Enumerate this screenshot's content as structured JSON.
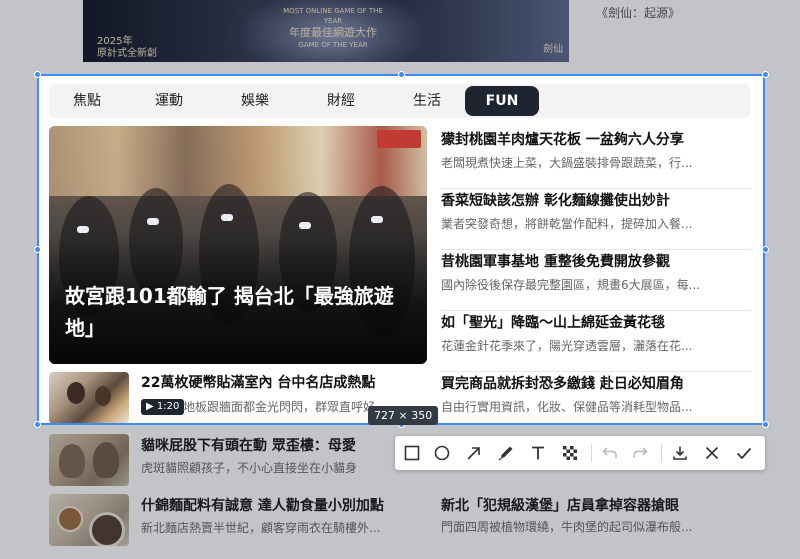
{
  "background": {
    "banner": {
      "left_text": "2025年\n原計式全新創",
      "mid_small": "MOST ONLINE GAME OF THE YEAR",
      "mid_big": "年度最佳網遊大作",
      "mid_small2": "GAME OF THE YEAR",
      "right_text": "劍仙"
    },
    "top_right_text": "《劍仙：起源》",
    "rows": [
      {
        "title": "貓咪屁股下有頭在動 眾歪樓：母愛",
        "subtitle": "虎斑貓照顧孩子，不小心直接坐在小貓身"
      },
      {
        "title": "什錦麵配料有誠意 達人勸食量小別加點",
        "subtitle": "新北麵店熱賣半世紀，顧客穿雨衣在騎樓外..."
      }
    ],
    "right_row": {
      "title": "新北「犯規級漢堡」店員拿掉容器搶眼",
      "subtitle": "門面四周被植物環繞，牛肉堡的起司似瀑布般..."
    }
  },
  "tabs": [
    {
      "label": "焦點"
    },
    {
      "label": "運動"
    },
    {
      "label": "娛樂"
    },
    {
      "label": "財經"
    },
    {
      "label": "生活"
    },
    {
      "label": "FUN"
    }
  ],
  "hero": {
    "title": "故宮跟101都輸了 揭台北「最強旅遊地」"
  },
  "side_news": [
    {
      "title": "獴封桃園羊肉爐天花板 一盆夠六人分享",
      "subtitle": "老闆現煮快速上菜，大鍋盛裝排骨跟蔬菜，行..."
    },
    {
      "title": "香菜短缺該怎辦 彰化麵線攤使出妙計",
      "subtitle": "業者突發奇想，將餅乾當作配料，提碎加入餐..."
    },
    {
      "title": "昔桃園軍事基地 重整後免費開放參觀",
      "subtitle": "國內除役後保存最完整園區，規畫6大展區，每..."
    },
    {
      "title": "如「聖光」降臨～山上綿延金黃花毯",
      "subtitle": "花蓮金針花季來了，陽光穿透雲層，灑落在花..."
    },
    {
      "title": "買完商品就拆封恐多繳錢 赴日必知眉角",
      "subtitle": "自由行實用資訊，化妝、保健品等消耗型物品..."
    }
  ],
  "bottom_left": {
    "title": "22萬枚硬幣貼滿室內 台中名店成熱點",
    "duration": "▶ 1:20",
    "subtitle": "地板跟牆面都金光閃閃，群眾直呼好"
  },
  "selection_size": "727 × 350",
  "toolbar": [
    {
      "icon": "rectangle-icon"
    },
    {
      "icon": "circle-icon"
    },
    {
      "icon": "arrow-icon"
    },
    {
      "icon": "pen-icon"
    },
    {
      "icon": "text-icon"
    },
    {
      "icon": "mosaic-icon"
    },
    {
      "icon": "undo-icon"
    },
    {
      "icon": "redo-icon"
    },
    {
      "icon": "download-icon"
    },
    {
      "icon": "close-icon"
    },
    {
      "icon": "check-icon"
    }
  ],
  "colors": {
    "selection_border": "#3b8cf5",
    "active_tab_bg": "#1f2530"
  }
}
